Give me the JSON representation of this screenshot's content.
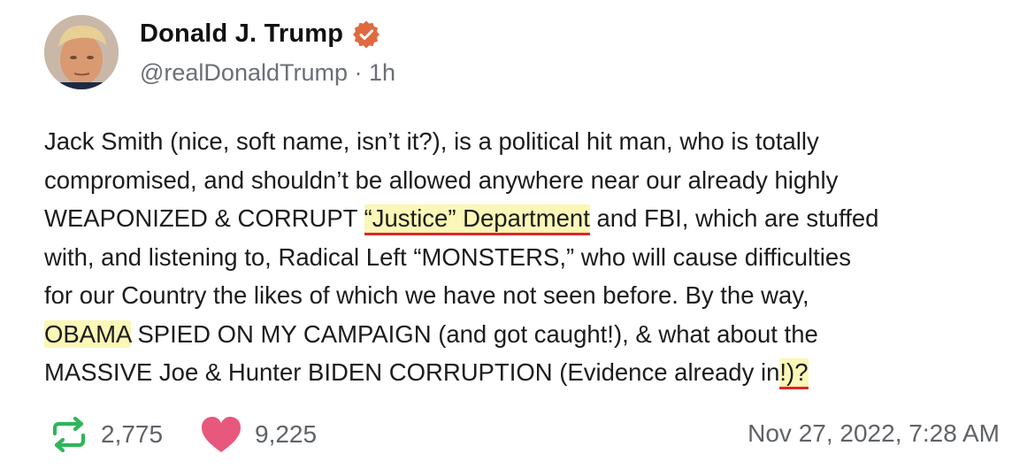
{
  "post": {
    "author": {
      "display_name": "Donald J. Trump",
      "handle": "@realDonaldTrump",
      "separator": "·",
      "time_ago": "1h",
      "verified": true,
      "verified_color": "#e06a40"
    },
    "text_lines": [
      [
        {
          "t": "Jack Smith (nice, soft name, isn’t it?), is a political hit man, who is totally"
        }
      ],
      [
        {
          "t": "compromised, and shouldn’t be allowed anywhere near our already highly"
        }
      ],
      [
        {
          "t": "WEAPONIZED & CORRUPT "
        },
        {
          "t": "“Justice” Department",
          "style": "highlight-underline"
        },
        {
          "t": " and FBI, which are stuffed"
        }
      ],
      [
        {
          "t": "with, and listening to, Radical Left “MONSTERS,” who will  cause difficulties"
        }
      ],
      [
        {
          "t": "for our Country the likes of which we have not seen before. By the way,"
        }
      ],
      [
        {
          "t": "OBAMA",
          "style": "highlight"
        },
        {
          "t": " SPIED ON MY CAMPAIGN (and got caught!), & what about the"
        }
      ],
      [
        {
          "t": "MASSIVE Joe & Hunter BIDEN CORRUPTION (Evidence already in"
        },
        {
          "t": "!)?",
          "style": "highlight-underline"
        }
      ]
    ],
    "stats": {
      "reposts": "2,775",
      "likes": "9,225",
      "repost_icon": "repost-icon",
      "like_icon": "heart-icon",
      "repost_color": "#2fb65a",
      "like_color": "#e8577c"
    },
    "timestamp": "Nov 27, 2022, 7:28 AM",
    "highlight_color": "#fbf7b6",
    "underline_color": "#e0242e"
  }
}
